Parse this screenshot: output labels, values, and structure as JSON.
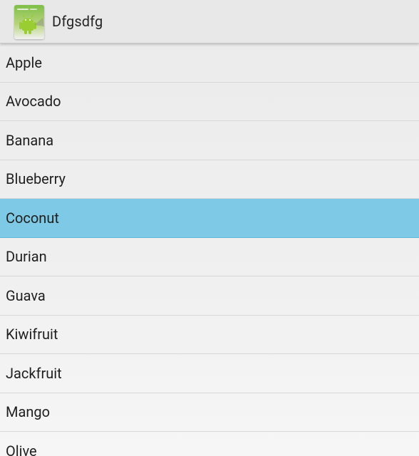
{
  "app": {
    "title": "Dfgsdfg",
    "icon": "android-app-icon"
  },
  "list": {
    "items": [
      "Apple",
      "Avocado",
      "Banana",
      "Blueberry",
      "Coconut",
      "Durian",
      "Guava",
      "Kiwifruit",
      "Jackfruit",
      "Mango",
      "Olive"
    ],
    "selected_item": "Coconut",
    "selected_color": "#7DC9E6"
  }
}
